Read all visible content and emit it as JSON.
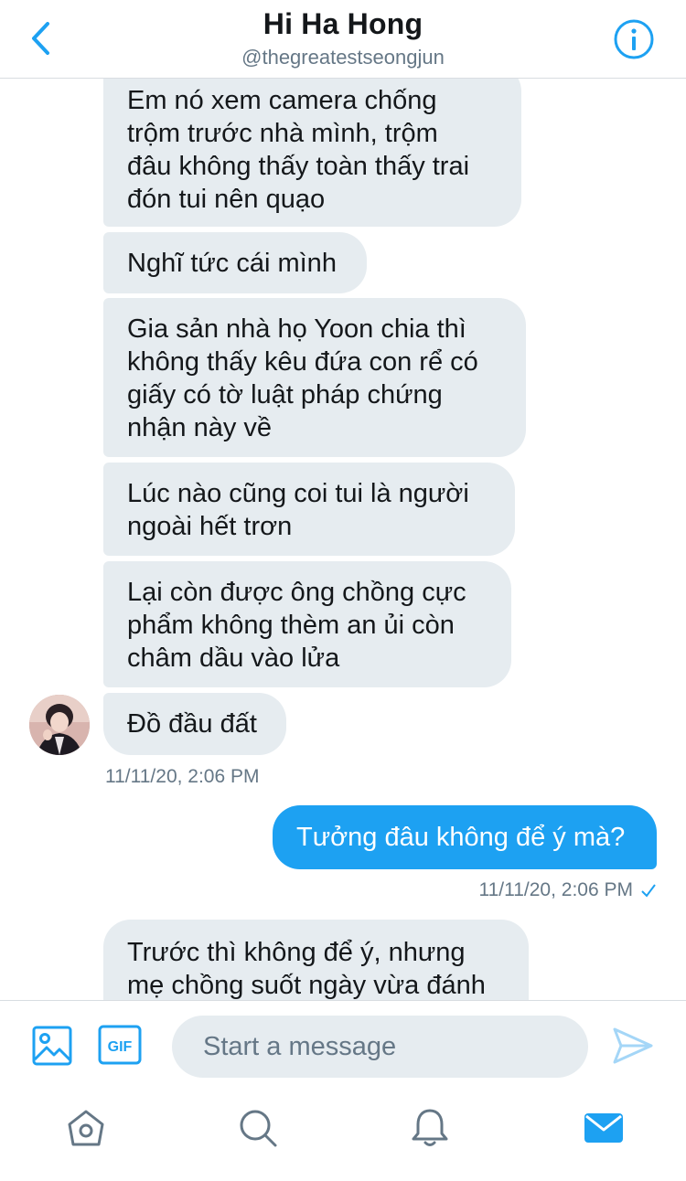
{
  "header": {
    "title": "Hi Ha Hong",
    "handle": "@thegreatestseongjun",
    "back_icon": "chevron-left-icon",
    "info_icon": "info-icon"
  },
  "colors": {
    "accent": "#1da1f2",
    "bubble_incoming": "#e6ecf0",
    "secondary_text": "#657786"
  },
  "messages": [
    {
      "from": "them",
      "lines": [
        "Em nó xem camera chống",
        "trộm trước nhà mình, trộm",
        "đâu không thấy toàn thấy trai",
        "đón tui nên quạo"
      ]
    },
    {
      "from": "them",
      "lines": [
        "Nghĩ tức cái mình"
      ]
    },
    {
      "from": "them",
      "lines": [
        "Gia sản nhà họ Yoon chia thì",
        "không thấy kêu đứa con rể có",
        "giấy có tờ luật pháp chứng",
        "nhận này về"
      ]
    },
    {
      "from": "them",
      "lines": [
        "Lúc nào cũng coi tui là người",
        "ngoài hết trơn"
      ]
    },
    {
      "from": "them",
      "lines": [
        "Lại còn được ông chồng cực",
        "phẩm không thèm an ủi còn",
        "châm dầu vào lửa"
      ]
    },
    {
      "from": "them",
      "lines": [
        "Đồ đầu đất"
      ]
    },
    {
      "from": "me",
      "lines": [
        "Tưởng đâu không để ý mà?"
      ]
    },
    {
      "from": "them",
      "lines": [
        "Trước thì không để ý, nhưng",
        "mẹ chồng suốt ngày vừa đánh"
      ]
    }
  ],
  "timestamps": {
    "incoming": "11/11/20, 2:06 PM",
    "outgoing": "11/11/20, 2:06 PM"
  },
  "composer": {
    "placeholder": "Start a message",
    "value": "",
    "gif_label": "GIF"
  },
  "tabbar": {
    "items": [
      "home-icon",
      "search-icon",
      "notifications-icon",
      "messages-icon"
    ],
    "active": "messages-icon"
  }
}
